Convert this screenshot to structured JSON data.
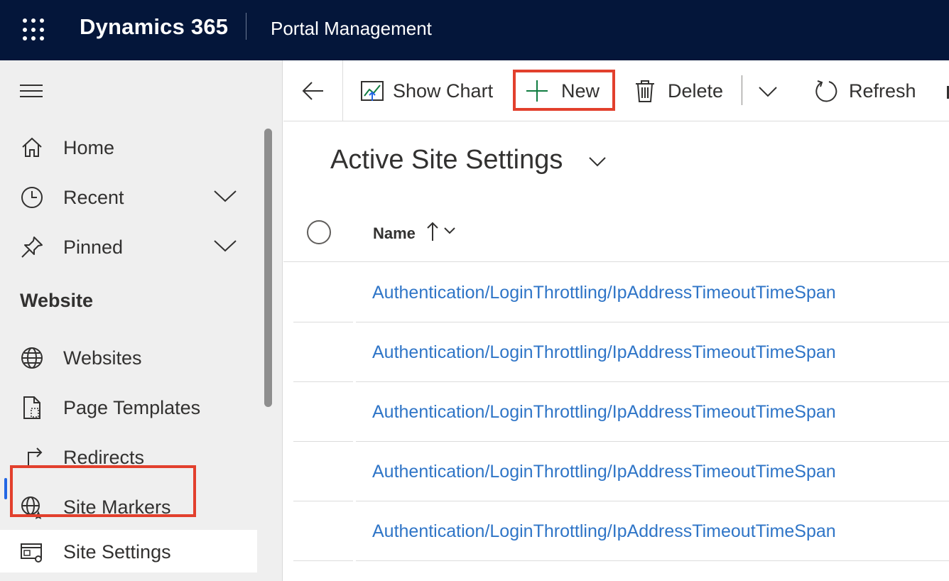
{
  "topbar": {
    "brand": "Dynamics 365",
    "app_name": "Portal Management"
  },
  "sidebar": {
    "top_items": [
      {
        "label": "Home",
        "icon": "home-icon"
      },
      {
        "label": "Recent",
        "icon": "clock-icon"
      },
      {
        "label": "Pinned",
        "icon": "pin-icon"
      }
    ],
    "section_title": "Website",
    "website_items": [
      {
        "label": "Websites",
        "icon": "globe-icon"
      },
      {
        "label": "Page Templates",
        "icon": "page-template-icon"
      },
      {
        "label": "Redirects",
        "icon": "redirect-icon"
      },
      {
        "label": "Site Markers",
        "icon": "globe-star-icon"
      },
      {
        "label": "Site Settings",
        "icon": "site-settings-icon",
        "selected": true
      }
    ]
  },
  "commandbar": {
    "show_chart": "Show Chart",
    "new": "New",
    "delete": "Delete",
    "refresh": "Refresh"
  },
  "view": {
    "title": "Active Site Settings",
    "column_name": "Name"
  },
  "rows": [
    "Authentication/LoginThrottling/IpAddressTimeoutTimeSpan",
    "Authentication/LoginThrottling/IpAddressTimeoutTimeSpan",
    "Authentication/LoginThrottling/IpAddressTimeoutTimeSpan",
    "Authentication/LoginThrottling/IpAddressTimeoutTimeSpan",
    "Authentication/LoginThrottling/IpAddressTimeoutTimeSpan"
  ],
  "colors": {
    "header_bg": "#04163a",
    "link": "#2f75c7",
    "highlight": "#e2402d",
    "accent": "#2266e3"
  }
}
